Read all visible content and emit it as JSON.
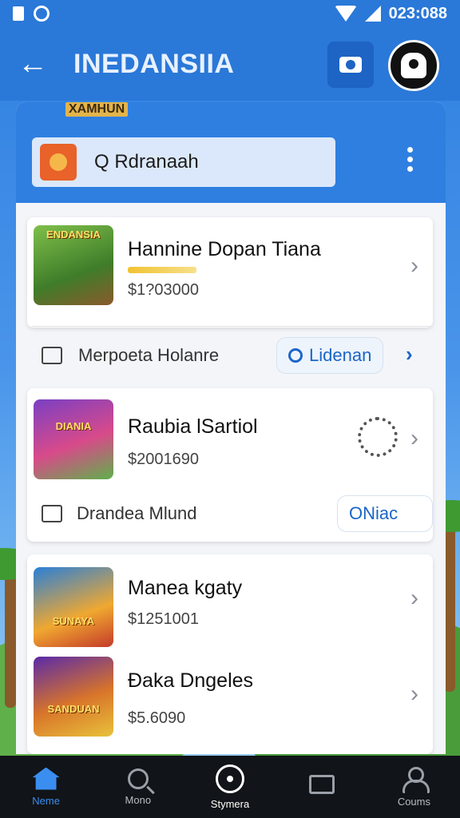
{
  "status_bar": {
    "time": "023:088"
  },
  "app_bar": {
    "title": "INEDANSIIA"
  },
  "panel": {
    "subtitle": "XAMHUN",
    "search_value": "Q Rdranaah"
  },
  "games": [
    {
      "thumb_label": "ENDANSIA",
      "title": "Hannine Dopan Tiana",
      "price": "$1?03000",
      "progress": 0.6,
      "action_row": {
        "label": "Merpoeta Holanre",
        "button": "Lidenan"
      }
    },
    {
      "thumb_label": "DIANIA",
      "title": "Raubia lSartiol",
      "price": "$2001690",
      "action_row": {
        "label": "Drandea Mlund",
        "button": "ONiac"
      }
    },
    {
      "thumb_label": "SUNAYA",
      "title": "Manea kgaty",
      "price": "$1251001"
    },
    {
      "thumb_label": "SANDUAN",
      "title": "Ðaka Dngeles",
      "price": "$5.6090"
    }
  ],
  "bottom_nav": [
    {
      "label": "Neme",
      "icon": "home-icon",
      "active": true
    },
    {
      "label": "Mono",
      "icon": "search-icon"
    },
    {
      "label": "Stymera",
      "icon": "gamepad-icon"
    },
    {
      "label": "",
      "icon": "screen-icon"
    },
    {
      "label": "Coums",
      "icon": "user-icon"
    }
  ],
  "colors": {
    "primary": "#2a78d8",
    "accent": "#1a66c8",
    "nav_background": "#111418"
  }
}
